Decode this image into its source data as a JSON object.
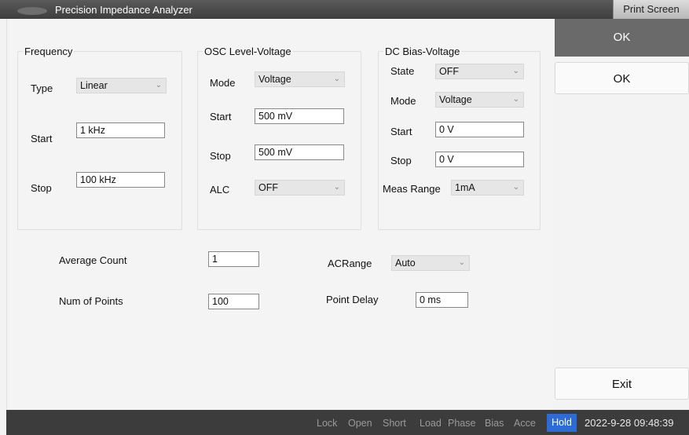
{
  "window": {
    "title": "Precision Impedance Analyzer",
    "print_screen": "Print Screen"
  },
  "frequency": {
    "title": "Frequency",
    "type_label": "Type",
    "type_value": "Linear",
    "start_label": "Start",
    "start_value": "1 kHz",
    "stop_label": "Stop",
    "stop_value": "100 kHz"
  },
  "osc": {
    "title": "OSC Level-Voltage",
    "mode_label": "Mode",
    "mode_value": "Voltage",
    "start_label": "Start",
    "start_value": "500 mV",
    "stop_label": "Stop",
    "stop_value": "500 mV",
    "alc_label": "ALC",
    "alc_value": "OFF"
  },
  "dc_bias": {
    "title": "DC Bias-Voltage",
    "state_label": "State",
    "state_value": "OFF",
    "mode_label": "Mode",
    "mode_value": "Voltage",
    "start_label": "Start",
    "start_value": "0 V",
    "stop_label": "Stop",
    "stop_value": "0 V",
    "range_label": "Meas Range",
    "range_value": "1mA"
  },
  "general": {
    "avg_label": "Average Count",
    "avg_value": "1",
    "points_label": "Num of Points",
    "points_value": "100",
    "acrange_label": "ACRange",
    "acrange_value": "Auto",
    "delay_label": "Point Delay",
    "delay_value": "0 ms"
  },
  "side": {
    "ok_primary": "OK",
    "ok_secondary": "OK",
    "exit": "Exit"
  },
  "status": {
    "lock": "Lock",
    "open": "Open",
    "short": "Short",
    "load": "Load",
    "phase": "Phase",
    "bias": "Bias",
    "acce": "Acce",
    "hold": "Hold",
    "datetime": "2022-9-28 09:48:39"
  },
  "colors": {
    "hold_active": "#2d6cd6",
    "titlebar": "#4a4a4a",
    "primary_button": "#6a6a6a"
  }
}
